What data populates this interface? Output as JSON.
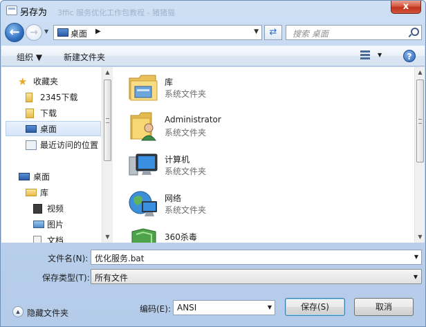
{
  "window": {
    "title": "另存为",
    "ghost_title": "3ffic 服务优化工作包教程 - 猪猪猫",
    "close": "x"
  },
  "nav": {
    "address": "桌面",
    "search_placeholder": "搜索 桌面"
  },
  "toolbar": {
    "organize": "组织 ▼",
    "new_folder": "新建文件夹",
    "help": "?"
  },
  "navpane": {
    "items": [
      {
        "label": "收藏夹",
        "icon": "star-icon"
      },
      {
        "label": "2345下载",
        "icon": "folder-icon"
      },
      {
        "label": "下载",
        "icon": "download-folder-icon"
      },
      {
        "label": "桌面",
        "icon": "desktop-icon",
        "selected": true
      },
      {
        "label": "最近访问的位置",
        "icon": "recent-places-icon"
      },
      {
        "label": "桌面",
        "icon": "desktop-icon"
      },
      {
        "label": "库",
        "icon": "library-icon"
      },
      {
        "label": "视频",
        "icon": "video-icon"
      },
      {
        "label": "图片",
        "icon": "pictures-icon"
      },
      {
        "label": "文档",
        "icon": "documents-icon"
      }
    ]
  },
  "files": [
    {
      "name": "库",
      "type": "系统文件夹",
      "icon": "library-folder-icon"
    },
    {
      "name": "Administrator",
      "type": "系统文件夹",
      "icon": "user-folder-icon"
    },
    {
      "name": "计算机",
      "type": "系统文件夹",
      "icon": "computer-icon"
    },
    {
      "name": "网络",
      "type": "系统文件夹",
      "icon": "network-icon"
    },
    {
      "name": "360杀毒",
      "type": "",
      "icon": "antivirus-shield-icon"
    }
  ],
  "form": {
    "filename_label": "文件名(N):",
    "filename_value": "优化服务.bat",
    "filetype_label": "保存类型(T):",
    "filetype_value": "所有文件",
    "encoding_label": "编码(E):",
    "encoding_value": "ANSI",
    "save": "保存(S)",
    "cancel": "取消",
    "hide_folders": "隐藏文件夹"
  },
  "colors": {
    "accent": "#2f6fc0",
    "close_red": "#c0331b"
  }
}
